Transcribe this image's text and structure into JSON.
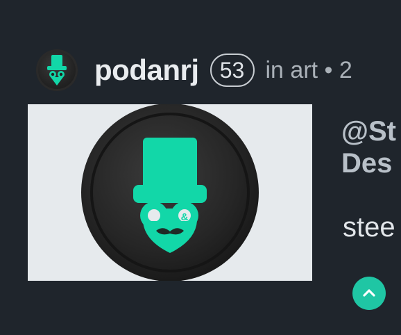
{
  "author": {
    "username": "podanrj",
    "reputation": "53",
    "category_text": "in art • 2",
    "avatar_icon": "steemit-hat-logo-icon"
  },
  "post": {
    "title_line1": "@St",
    "title_line2": "Des",
    "body_preview": "stee"
  },
  "actions": {
    "upvote_icon": "chevron-up-icon"
  },
  "colors": {
    "background": "#1f252c",
    "accent": "#1fc6a4",
    "logo_green": "#12d7a8",
    "thumbnail_bg": "#e6eaed"
  }
}
